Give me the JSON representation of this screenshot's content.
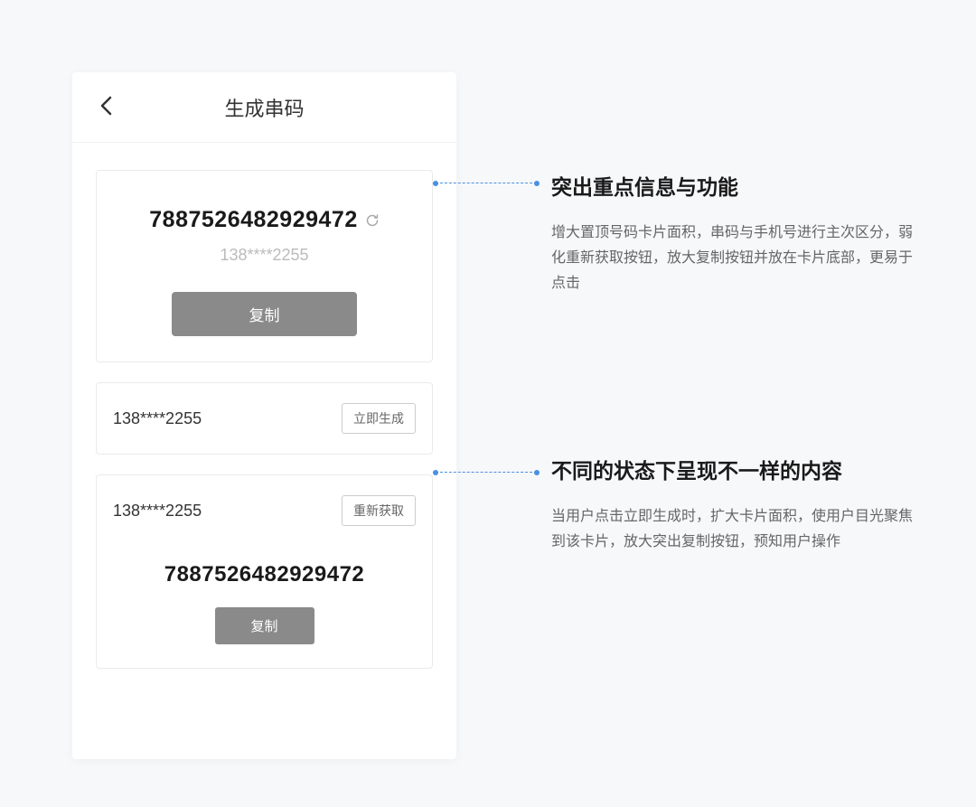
{
  "nav": {
    "title": "生成串码"
  },
  "cards": {
    "primary": {
      "serial": "7887526482929472",
      "phone": "138****2255",
      "copy_label": "复制"
    },
    "pending": {
      "phone": "138****2255",
      "generate_label": "立即生成"
    },
    "expanded": {
      "phone": "138****2255",
      "refetch_label": "重新获取",
      "serial": "7887526482929472",
      "copy_label": "复制"
    }
  },
  "annotations": {
    "a1": {
      "title": "突出重点信息与功能",
      "desc": "增大置顶号码卡片面积，串码与手机号进行主次区分，弱化重新获取按钮，放大复制按钮并放在卡片底部，更易于点击"
    },
    "a2": {
      "title": "不同的状态下呈现不一样的内容",
      "desc": "当用户点击立即生成时，扩大卡片面积，使用户目光聚焦到该卡片，放大突出复制按钮，预知用户操作"
    }
  }
}
